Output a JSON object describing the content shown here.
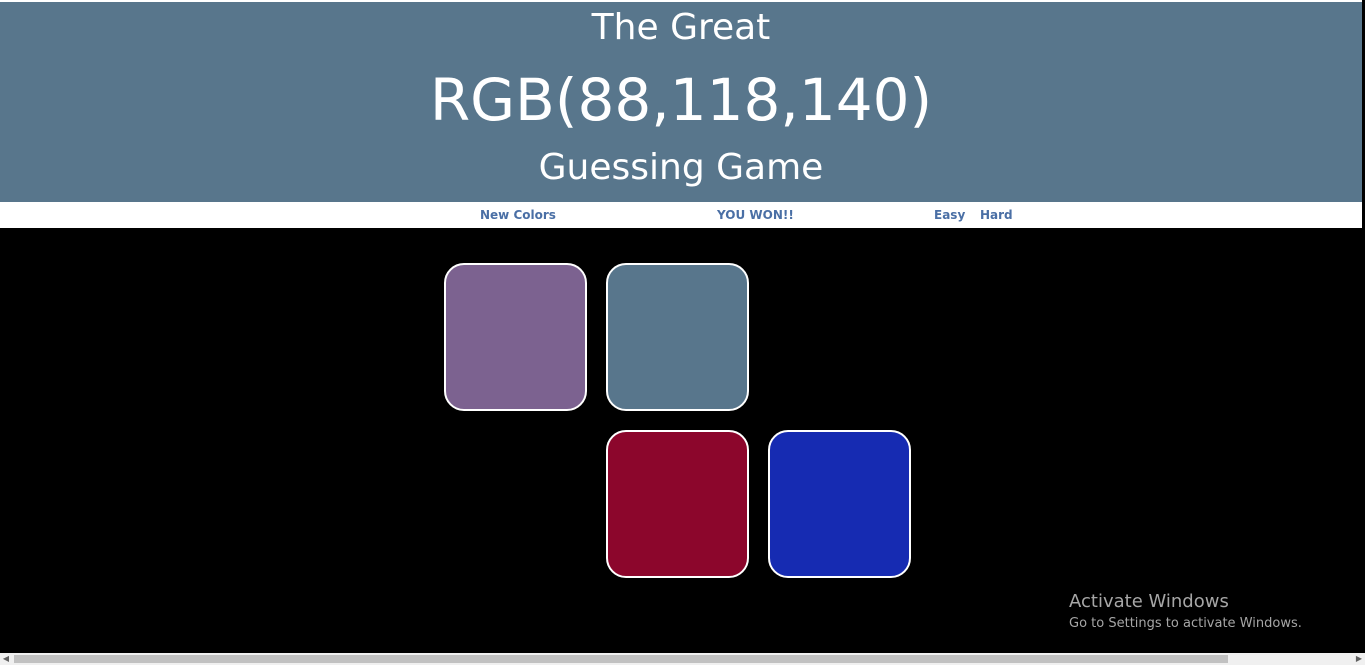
{
  "header": {
    "line1": "The Great",
    "rgb_text": "RGB(88,118,140)",
    "line3": "Guessing Game",
    "background": "#58768c"
  },
  "controls": {
    "new_colors_label": "New Colors",
    "message": "YOU WON!!",
    "easy_label": "Easy",
    "hard_label": "Hard",
    "text_color": "#4a6fa5"
  },
  "squares": [
    {
      "color": "#7c6290",
      "visible": true
    },
    {
      "color": "#58768c",
      "visible": true
    },
    {
      "color": "#000000",
      "visible": false
    },
    {
      "color": "#000000",
      "visible": false
    },
    {
      "color": "#8c062c",
      "visible": true
    },
    {
      "color": "#162bb2",
      "visible": true
    }
  ],
  "watermark": {
    "title": "Activate Windows",
    "subtitle": "Go to Settings to activate Windows."
  },
  "scrollbar": {
    "left_arrow_icon": "chevron-left-icon",
    "right_arrow_icon": "chevron-right-icon"
  }
}
